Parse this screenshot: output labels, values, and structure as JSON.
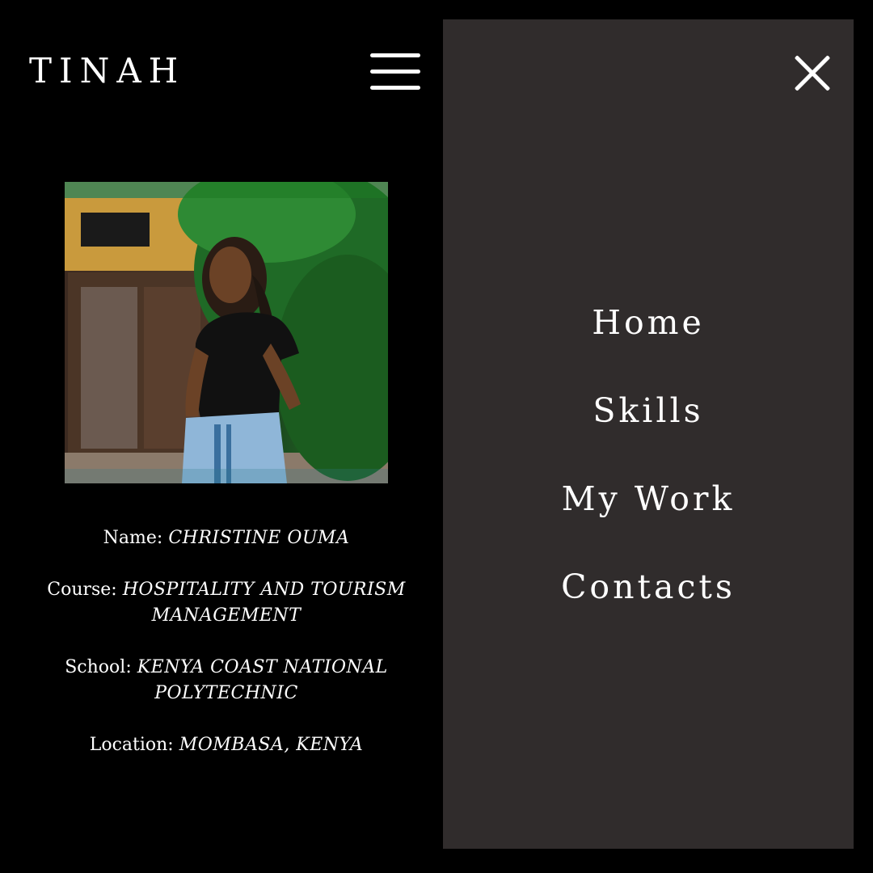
{
  "header": {
    "brand": "TINAH",
    "menu_icon": "hamburger-menu-icon"
  },
  "profile": {
    "photo_alt": "Profile photo",
    "name_label": "Name:",
    "name_value": "CHRISTINE OUMA",
    "course_label": "Course:",
    "course_value": "HOSPITALITY AND TOURISM MANAGEMENT",
    "school_label": "School:",
    "school_value": "KENYA COAST NATIONAL POLYTECHNIC",
    "location_label": "Location:",
    "location_value": "MOMBASA, KENYA"
  },
  "drawer": {
    "close_icon": "close-icon",
    "items": [
      {
        "label": "Home"
      },
      {
        "label": "Skills"
      },
      {
        "label": "My Work"
      },
      {
        "label": "Contacts"
      }
    ]
  },
  "colors": {
    "background": "#000000",
    "drawer": "#302c2c",
    "text": "#ffffff"
  }
}
